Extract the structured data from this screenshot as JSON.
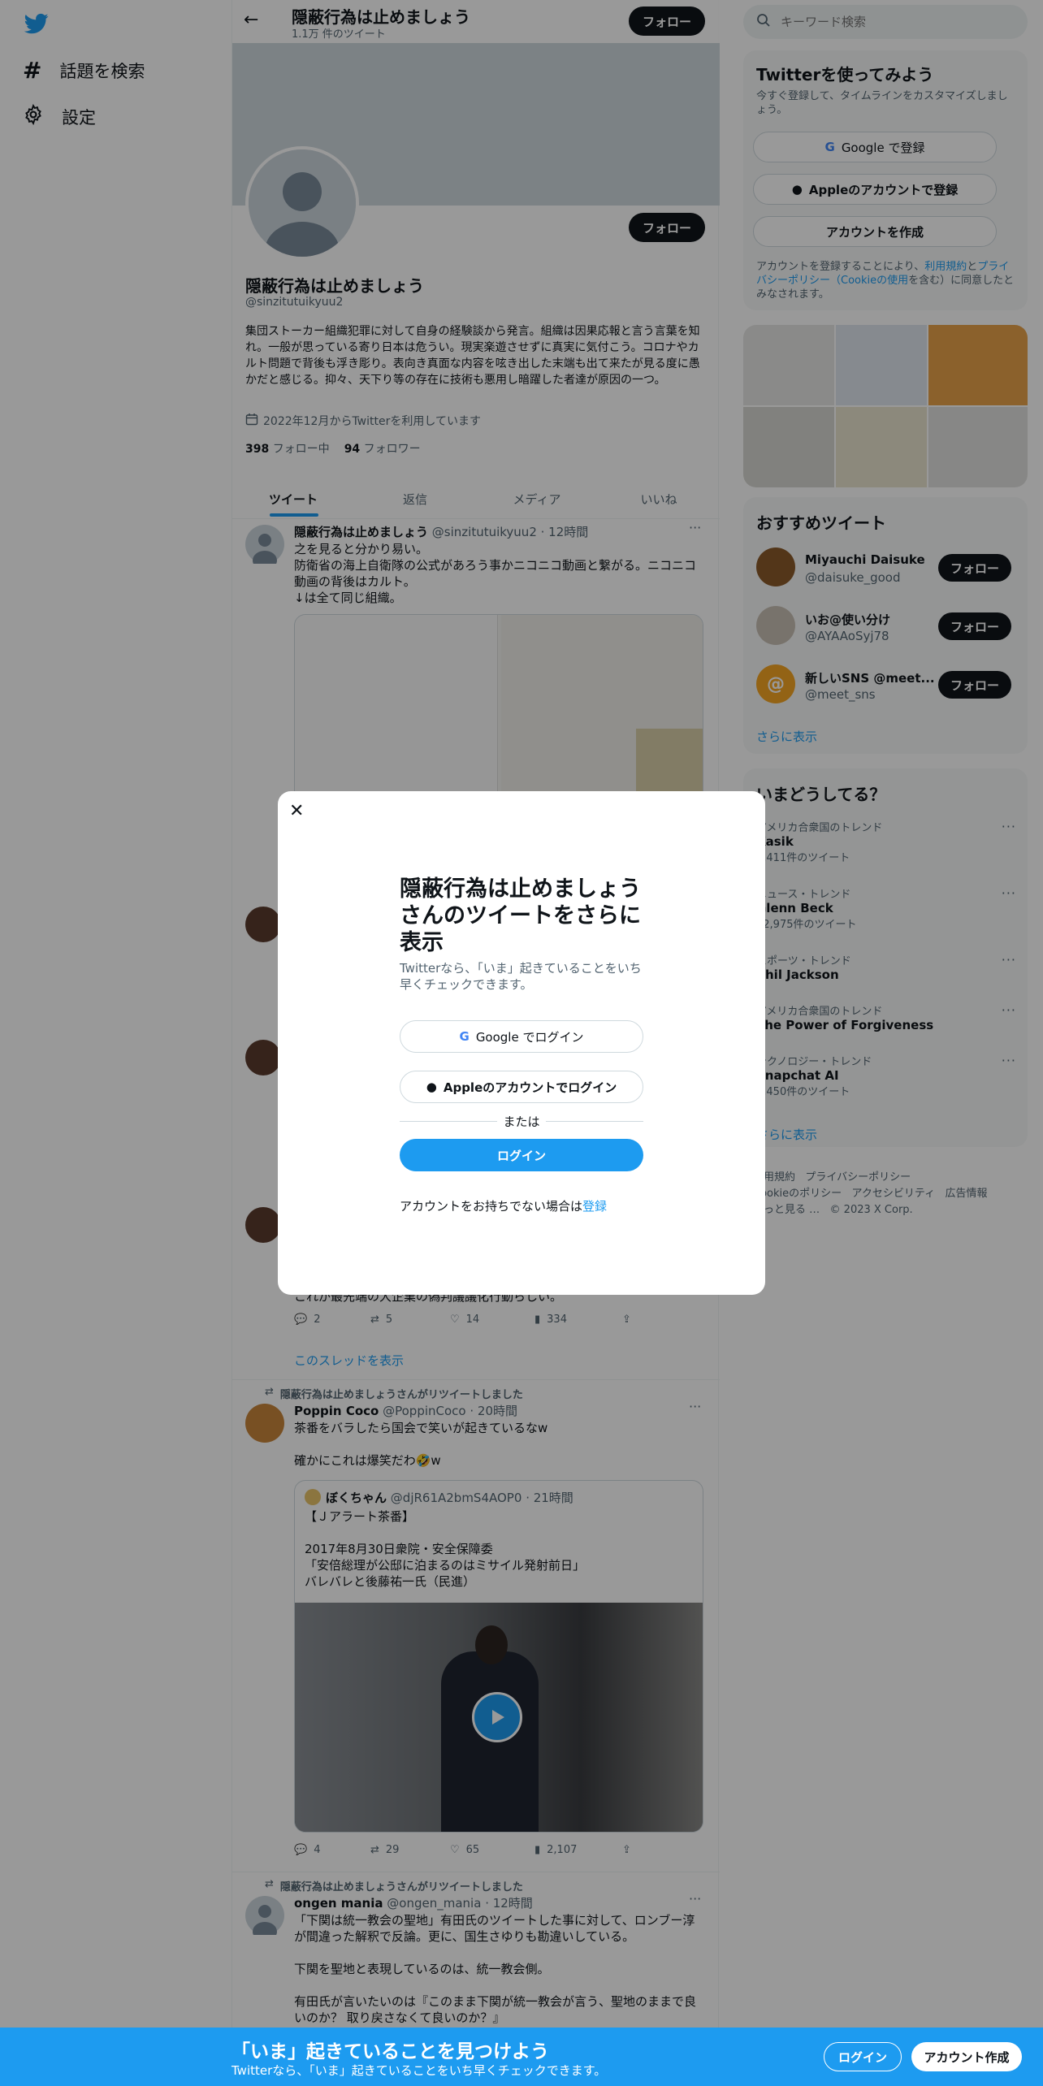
{
  "nav": {
    "explore_label": "話題を検索",
    "settings_label": "設定"
  },
  "header": {
    "name": "隠蔽行為は止めましょう",
    "tweet_count": "1.1万 件のツイート",
    "follow_label": "フォロー"
  },
  "profile": {
    "name": "隠蔽行為は止めましょう",
    "handle": "@sinzitutuikyuu2",
    "follow_label": "フォロー",
    "bio": "集団ストーカー組織犯罪に対して自身の経験談から発言。組織は因果応報と言う言葉を知れ。一般が思っている寄り日本は危うい。現実楽遊させずに真実に気付こう。コロナやカルト問題で背後も浮き彫り。表向き真面な内容を呟き出した末端も出て来たが見る度に愚かだと感じる。抑々、天下り等の存在に技術も悪用し暗躍した者達が原因の一つ。",
    "joined": "2022年12月からTwitterを利用しています",
    "following_count": "398",
    "following_label": "フォロー中",
    "followers_count": "94",
    "followers_label": "フォロワー"
  },
  "tabs": [
    "ツイート",
    "返信",
    "メディア",
    "いいね"
  ],
  "tweet1": {
    "name": "隠蔽行為は止めましょう",
    "handle": "@sinzitutuikyuu2",
    "time": "· 12時間",
    "text": "之を見ると分かり易い。\n防衛省の海上自衛隊の公式があろう事かニコニコ動画と繋がる。ニコニコ動画の背後はカルト。\n↓は全て同じ組織。"
  },
  "tweet_thread": {
    "text_tail": "これが最先端の大企業の偽判議議化行動らしい。",
    "replies": "2",
    "retweets": "5",
    "likes": "14",
    "views": "334",
    "show_thread": "このスレッドを表示"
  },
  "tweet2": {
    "rt_label": "隠蔽行為は止めましょうさんがリツイートしました",
    "name": "Poppin Coco",
    "handle": "@PoppinCoco",
    "time": "· 20時間",
    "text": "茶番をバラしたら国会で笑いが起きているなw\n\n確かにこれは爆笑だわ🤣w",
    "quote_name": "ぼくちゃん",
    "quote_handle": "@djR61A2bmS4AOP0",
    "quote_time": "· 21時間",
    "quote_text": "【Ｊアラート茶番】\n\n2017年8月30日衆院・安全保障委\n「安倍総理が公邸に泊まるのはミサイル発射前日」\nバレバレと後藤祐一氏（民進）",
    "replies": "4",
    "retweets": "29",
    "likes": "65",
    "views": "2,107"
  },
  "tweet3": {
    "rt_label": "隠蔽行為は止めましょうさんがリツイートしました",
    "name": "ongen mania",
    "handle": "@ongen_mania",
    "time": "· 12時間",
    "text": "「下関は統一教会の聖地」有田氏のツイートした事に対して、ロンブー淳が間違った解釈で反論。更に、国生さゆりも勘違いしている。\n\n下関を聖地と表現しているのは、統一教会側。\n\n有田氏が言いたいのは『このまま下関が統一教会が言う、聖地のままで良いのか？ 取り戻さなくて良いのか？』"
  },
  "search": {
    "placeholder": "キーワード検索"
  },
  "signup": {
    "title": "Twitterを使ってみよう",
    "subtitle": "今すぐ登録して、タイムラインをカスタマイズしましょう。",
    "google_label": "Google で登録",
    "apple_label": "Appleのアカウントで登録",
    "create_label": "アカウントを作成",
    "legal_pre": "アカウントを登録することにより、",
    "legal_terms": "利用規約",
    "legal_mid": "と",
    "legal_privacy": "プライバシーポリシー（Cookieの使用",
    "legal_post": "を含む）に同意したとみなされます。"
  },
  "recommended": {
    "title": "おすすめツイート",
    "users": [
      {
        "name": "Miyauchi Daisuke",
        "handle": "@daisuke_good",
        "follow": "フォロー"
      },
      {
        "name": "いお@使い分け",
        "handle": "@AYAAoSyj78",
        "follow": "フォロー"
      },
      {
        "name": "新しいSNS @meet...",
        "handle": "@meet_sns",
        "follow": "フォロー"
      }
    ],
    "more": "さらに表示"
  },
  "trends": {
    "title": "いまどうしてる？",
    "items": [
      {
        "category": "アメリカ合衆国のトレンド",
        "name": "Kasik",
        "count": "2,411件のツイート"
      },
      {
        "category": "ニュース・トレンド",
        "name": "Glenn Beck",
        "count": "12,975件のツイート"
      },
      {
        "category": "スポーツ・トレンド",
        "name": "Phil Jackson",
        "count": ""
      },
      {
        "category": "アメリカ合衆国のトレンド",
        "name": "The Power of Forgiveness",
        "count": ""
      },
      {
        "category": "テクノロジー・トレンド",
        "name": "Snapchat AI",
        "count": "5,450件のツイート"
      }
    ],
    "more": "さらに表示"
  },
  "footer": {
    "terms": "利用規約",
    "privacy": "プライバシーポリシー",
    "cookie": "Cookieのポリシー",
    "accessibility": "アクセシビリティ",
    "ads": "広告情報",
    "more": "もっと見る …",
    "copyright": "© 2023 X Corp."
  },
  "modal": {
    "title": "隠蔽行為は止めましょうさんのツイートをさらに表示",
    "subtitle": "Twitterなら、「いま」起きていることをいち早くチェックできます。",
    "google_label": "Google でログイン",
    "apple_label": "Appleのアカウントでログイン",
    "or": "または",
    "login_label": "ログイン",
    "no_account": "アカウントをお持ちでない場合は",
    "signup_link": "登録"
  },
  "bottombar": {
    "title": "「いま」起きていることを見つけよう",
    "subtitle": "Twitterなら、「いま」起きていることをいち早くチェックできます。",
    "login_label": "ログイン",
    "signup_label": "アカウント作成"
  },
  "colors": {
    "brand": "#1d9bf0",
    "text": "#0f1419",
    "muted": "#536471"
  }
}
